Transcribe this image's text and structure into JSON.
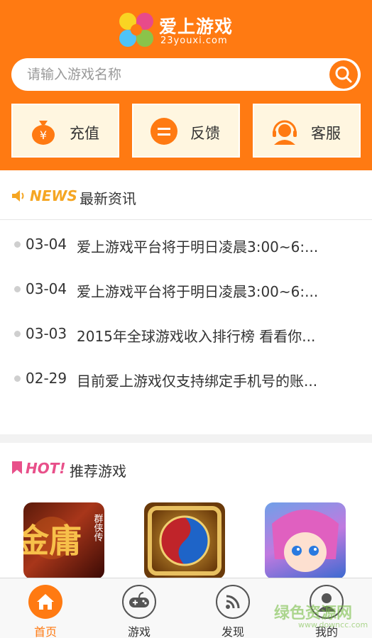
{
  "header": {
    "logo_title": "爱上游戏",
    "logo_sub": "23youxi.com",
    "search_placeholder": "请输入游戏名称"
  },
  "quick_actions": [
    {
      "label": "充值",
      "icon": "money-bag-icon"
    },
    {
      "label": "反馈",
      "icon": "feedback-icon"
    },
    {
      "label": "客服",
      "icon": "headset-icon"
    }
  ],
  "news": {
    "badge": "NEWS",
    "title": "最新资讯",
    "items": [
      {
        "date": "03-04",
        "title": "爱上游戏平台将于明日凌晨3:00~6:..."
      },
      {
        "date": "03-04",
        "title": "爱上游戏平台将于明日凌晨3:00~6:..."
      },
      {
        "date": "03-03",
        "title": "2015年全球游戏收入排行榜 看看你..."
      },
      {
        "date": "02-29",
        "title": "目前爱上游戏仅支持绑定手机号的账..."
      }
    ]
  },
  "hot": {
    "badge": "HOT!",
    "title": "推荐游戏",
    "games": [
      {
        "icon_text_1": "金庸",
        "icon_text_2": "群侠传"
      },
      {
        "icon_text_1": "",
        "icon_text_2": ""
      },
      {
        "icon_text_1": "",
        "icon_text_2": ""
      }
    ]
  },
  "tabbar": [
    {
      "label": "首页",
      "icon": "home-icon",
      "active": true
    },
    {
      "label": "游戏",
      "icon": "gamepad-icon",
      "active": false
    },
    {
      "label": "发现",
      "icon": "rss-icon",
      "active": false
    },
    {
      "label": "我的",
      "icon": "user-icon",
      "active": false
    }
  ],
  "watermark": {
    "text": "绿色资源网",
    "sub": "www.downcc.com"
  },
  "colors": {
    "accent": "#ff7a12",
    "quick_bg": "#fff6e0",
    "news_badge": "#f5a623",
    "hot_badge": "#e8508a"
  }
}
